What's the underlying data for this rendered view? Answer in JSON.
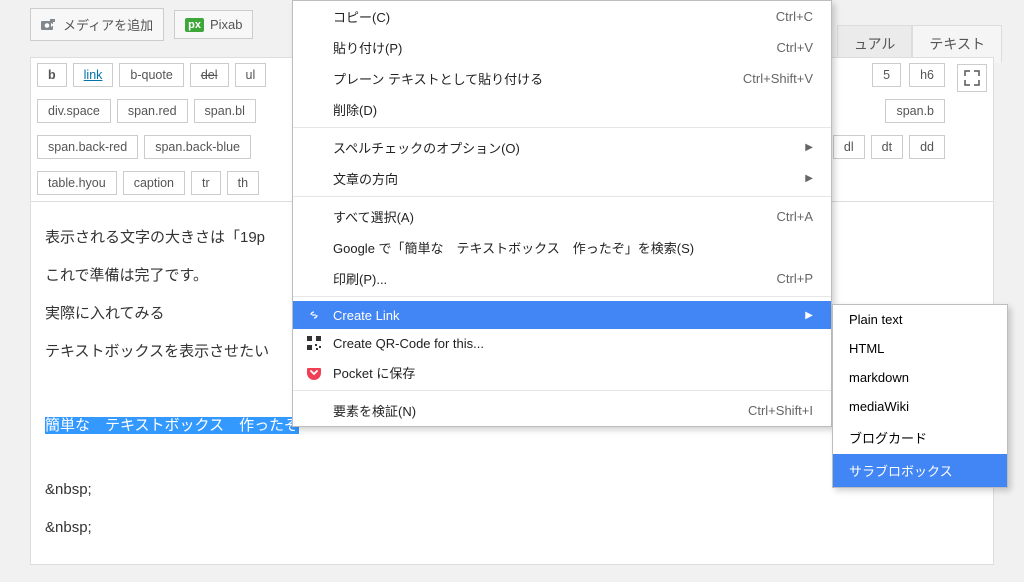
{
  "toolbar": {
    "media_label": "メディアを追加",
    "pixabay_label": "Pixab"
  },
  "tabs": {
    "visual": "ュアル",
    "text": "テキスト"
  },
  "quicktags": {
    "row1": [
      "b",
      "link",
      "b-quote",
      "del",
      "ul",
      "5",
      "h6"
    ],
    "row2": [
      "div.space",
      "span.red",
      "span.bl",
      "span.b"
    ],
    "row3": [
      "span.back-red",
      "span.back-blue",
      "dl",
      "dt",
      "dd"
    ],
    "row4": [
      "table.hyou",
      "caption",
      "tr",
      "th"
    ]
  },
  "editor": {
    "line1": "表示される文字の大きさは「19p",
    "line2": "これで準備は完了です。",
    "line3": "実際に入れてみる",
    "line4": "テキストボックスを表示させたい",
    "selected": "簡単な　テキストボックス　作ったぞ",
    "nbsp": "&nbsp;"
  },
  "context_menu": [
    {
      "label": "コピー(C)",
      "shortcut": "Ctrl+C"
    },
    {
      "label": "貼り付け(P)",
      "shortcut": "Ctrl+V"
    },
    {
      "label": "プレーン テキストとして貼り付ける",
      "shortcut": "Ctrl+Shift+V"
    },
    {
      "label": "削除(D)",
      "shortcut": "",
      "sep_after": true
    },
    {
      "label": "スペルチェックのオプション(O)",
      "arrow": true
    },
    {
      "label": "文章の方向",
      "arrow": true,
      "sep_after": true
    },
    {
      "label": "すべて選択(A)",
      "shortcut": "Ctrl+A"
    },
    {
      "label": "Google で「簡単な　テキストボックス　作ったぞ」を検索(S)"
    },
    {
      "label": "印刷(P)...",
      "shortcut": "Ctrl+P",
      "sep_after": true
    },
    {
      "label": "Create Link",
      "icon": "link",
      "arrow": true,
      "active": true
    },
    {
      "label": "Create QR-Code for this...",
      "icon": "qr"
    },
    {
      "label": "Pocket に保存",
      "icon": "pocket",
      "sep_after": true
    },
    {
      "label": "要素を検証(N)",
      "shortcut": "Ctrl+Shift+I"
    }
  ],
  "submenu": [
    {
      "label": "Plain text"
    },
    {
      "label": "HTML"
    },
    {
      "label": "markdown"
    },
    {
      "label": "mediaWiki"
    },
    {
      "label": "ブログカード"
    },
    {
      "label": "サラブロボックス",
      "active": true
    }
  ]
}
